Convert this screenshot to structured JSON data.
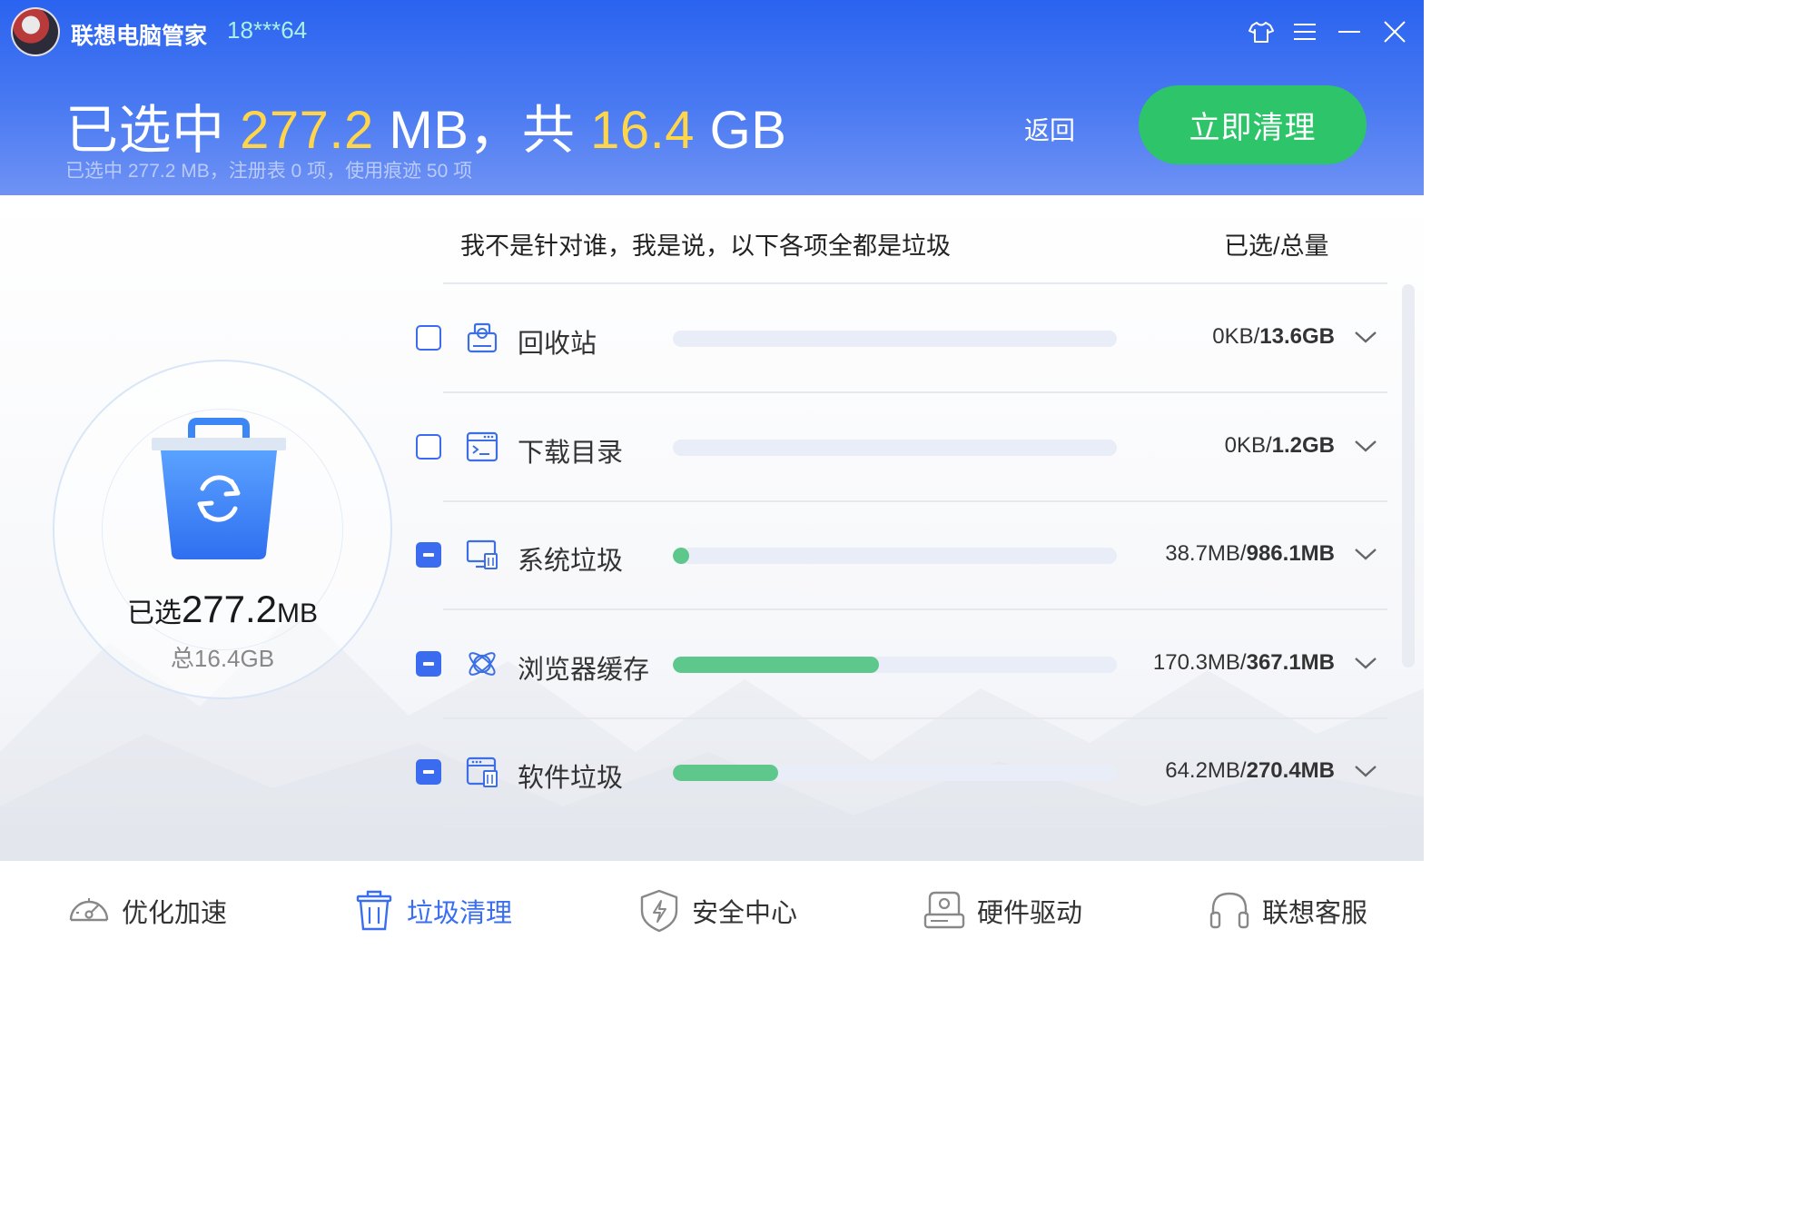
{
  "app": {
    "name": "联想电脑管家",
    "user_id": "18***64"
  },
  "window_controls": [
    "skin-icon",
    "menu-icon",
    "minimize-icon",
    "close-icon"
  ],
  "header": {
    "headline_prefix": "已选中",
    "headline_selected": "277.2",
    "headline_selected_unit": "MB，共",
    "headline_total": "16.4",
    "headline_total_unit": "GB",
    "subline": "已选中 277.2 MB，注册表 0 项，使用痕迹 50 项",
    "back_label": "返回",
    "clean_button_label": "立即清理"
  },
  "summary": {
    "selected_label": "已选",
    "selected_value": "277.2",
    "selected_unit": "MB",
    "total_text": "总16.4GB"
  },
  "list": {
    "title": "我不是针对谁，我是说，以下各项全都是垃圾",
    "column_right": "已选/总量",
    "items": [
      {
        "label": "回收站",
        "icon": "recycle-bin-icon",
        "checked": "unchecked",
        "selected": "0KB/",
        "total": "13.6GB",
        "fraction": 0.0
      },
      {
        "label": "下载目录",
        "icon": "download-folder-icon",
        "checked": "unchecked",
        "selected": "0KB/",
        "total": "1.2GB",
        "fraction": 0.0
      },
      {
        "label": "系统垃圾",
        "icon": "system-junk-icon",
        "checked": "partial",
        "selected": "38.7MB/",
        "total": "986.1MB",
        "fraction": 0.039
      },
      {
        "label": "浏览器缓存",
        "icon": "browser-cache-icon",
        "checked": "partial",
        "selected": "170.3MB/",
        "total": "367.1MB",
        "fraction": 0.464
      },
      {
        "label": "软件垃圾",
        "icon": "software-junk-icon",
        "checked": "partial",
        "selected": "64.2MB/",
        "total": "270.4MB",
        "fraction": 0.237
      }
    ]
  },
  "colors": {
    "header_blue": "#2a63f0",
    "accent_yellow": "#ffd54a",
    "clean_green": "#2dc46a",
    "progress_green": "#5ec78c",
    "active_nav_blue": "#3a6ef2"
  },
  "nav": {
    "items": [
      {
        "label": "优化加速",
        "icon": "speedometer-icon",
        "active": false
      },
      {
        "label": "垃圾清理",
        "icon": "trash-icon",
        "active": true
      },
      {
        "label": "安全中心",
        "icon": "shield-icon",
        "active": false
      },
      {
        "label": "硬件驱动",
        "icon": "hard-drive-icon",
        "active": false
      },
      {
        "label": "联想客服",
        "icon": "headset-icon",
        "active": false
      }
    ]
  }
}
